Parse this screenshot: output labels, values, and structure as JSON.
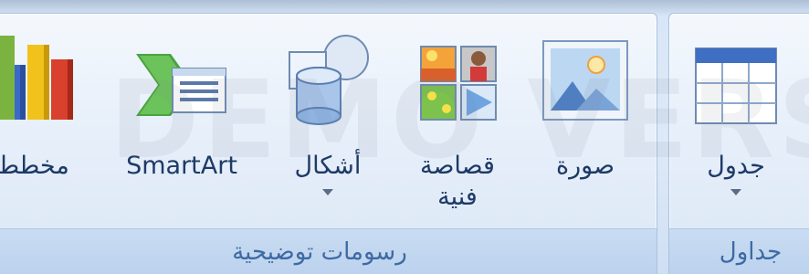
{
  "watermark": "DEMO VERSION",
  "groups": {
    "illustrations": {
      "label": "رسومات توضيحية",
      "buttons": {
        "chart": {
          "label": "مخطط"
        },
        "smartart": {
          "label": "SmartArt"
        },
        "shapes": {
          "label": "أشكال"
        },
        "clipart": {
          "label": "قصاصة",
          "label2": "فنية"
        },
        "picture": {
          "label": "صورة"
        }
      }
    },
    "tables": {
      "label": "جداول",
      "buttons": {
        "table": {
          "label": "جدول"
        }
      }
    }
  },
  "colors": {
    "label_text": "#1e3a66",
    "group_label_text": "#3e6aa3",
    "ribbon_bg": "#dde9f8"
  }
}
